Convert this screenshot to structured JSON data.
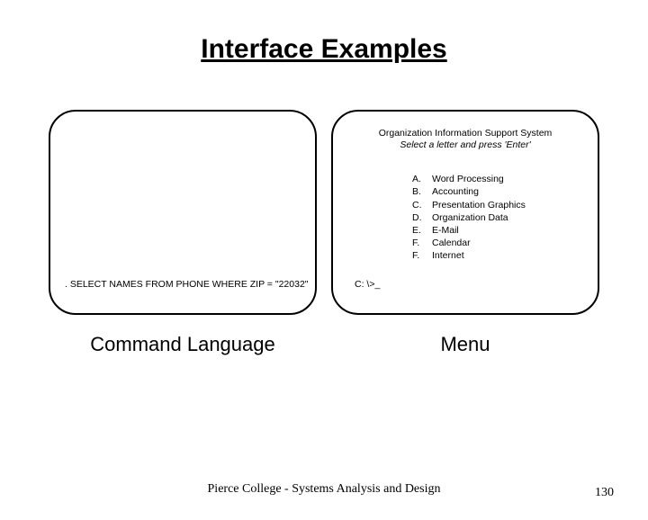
{
  "title": "Interface Examples",
  "left_panel": {
    "command": ". SELECT NAMES FROM PHONE WHERE ZIP = \"22032\"",
    "label": "Command Language"
  },
  "right_panel": {
    "header": "Organization Information Support System",
    "subtitle": "Select a letter and press 'Enter'",
    "menu": [
      {
        "letter": "A.",
        "text": "Word Processing"
      },
      {
        "letter": "B.",
        "text": "Accounting"
      },
      {
        "letter": "C.",
        "text": "Presentation Graphics"
      },
      {
        "letter": "D.",
        "text": "Organization Data"
      },
      {
        "letter": "E.",
        "text": "E-Mail"
      },
      {
        "letter": "F.",
        "text": "Calendar"
      },
      {
        "letter": "F.",
        "text": "Internet"
      }
    ],
    "prompt": "C: \\>_",
    "label": "Menu"
  },
  "footer": "Pierce College - Systems Analysis and Design",
  "page_number": "130"
}
